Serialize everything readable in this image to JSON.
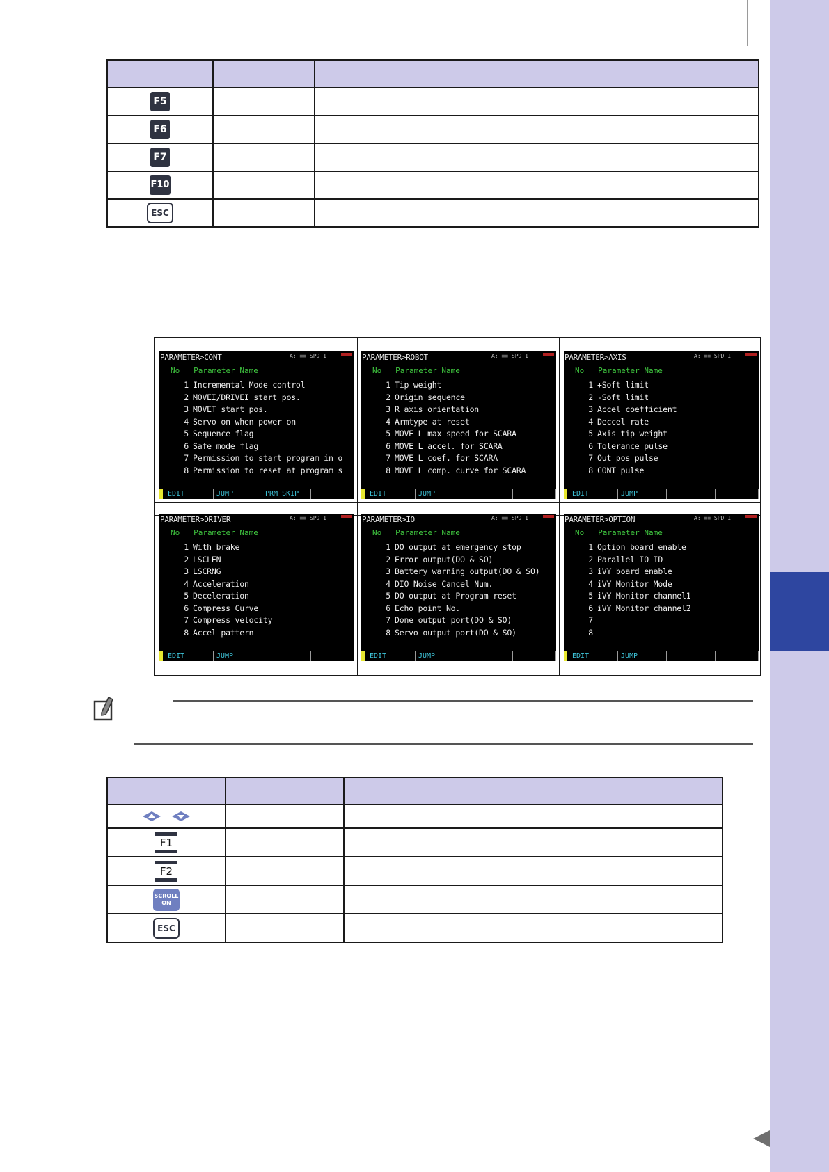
{
  "table1": {
    "header": [
      "",
      "",
      ""
    ],
    "rows": [
      {
        "key": "F5",
        "name": "",
        "desc": ""
      },
      {
        "key": "F6",
        "name": "",
        "desc": ""
      },
      {
        "key": "F7",
        "name": "",
        "desc": ""
      },
      {
        "key": "F10",
        "name": "",
        "desc": ""
      },
      {
        "key": "ESC",
        "name": "",
        "desc": ""
      }
    ]
  },
  "screens": [
    {
      "title": "PARAMETER>CONT",
      "status": "A: ≡≡ SPD 1",
      "head": "No   Parameter Name",
      "rows": [
        {
          "no": "1",
          "name": "Incremental Mode control"
        },
        {
          "no": "2",
          "name": "MOVEI/DRIVEI start pos."
        },
        {
          "no": "3",
          "name": "MOVET start pos."
        },
        {
          "no": "4",
          "name": "Servo on when power on"
        },
        {
          "no": "5",
          "name": "Sequence flag"
        },
        {
          "no": "6",
          "name": "Safe mode flag"
        },
        {
          "no": "7",
          "name": "Permission to start program in o"
        },
        {
          "no": "8",
          "name": "Permission to reset at program s"
        }
      ],
      "footer": [
        "EDIT",
        "JUMP",
        "PRM SKIP",
        ""
      ]
    },
    {
      "title": "PARAMETER>ROBOT",
      "status": "A: ≡≡ SPD 1",
      "head": "No   Parameter Name",
      "rows": [
        {
          "no": "1",
          "name": "Tip weight"
        },
        {
          "no": "2",
          "name": "Origin sequence"
        },
        {
          "no": "3",
          "name": "R axis orientation"
        },
        {
          "no": "4",
          "name": "Armtype at reset"
        },
        {
          "no": "5",
          "name": "MOVE L max speed for SCARA"
        },
        {
          "no": "6",
          "name": "MOVE L accel. for SCARA"
        },
        {
          "no": "7",
          "name": "MOVE L coef. for SCARA"
        },
        {
          "no": "8",
          "name": "MOVE L comp. curve for SCARA"
        }
      ],
      "footer": [
        "EDIT",
        "JUMP",
        "",
        ""
      ]
    },
    {
      "title": "PARAMETER>AXIS",
      "status": "A: ≡≡ SPD 1",
      "head": "No   Parameter Name",
      "rows": [
        {
          "no": "1",
          "name": "+Soft limit"
        },
        {
          "no": "2",
          "name": "-Soft limit"
        },
        {
          "no": "3",
          "name": "Accel coefficient"
        },
        {
          "no": "4",
          "name": "Deccel rate"
        },
        {
          "no": "5",
          "name": "Axis tip weight"
        },
        {
          "no": "6",
          "name": "Tolerance pulse"
        },
        {
          "no": "7",
          "name": "Out pos pulse"
        },
        {
          "no": "8",
          "name": "CONT pulse"
        }
      ],
      "footer": [
        "EDIT",
        "JUMP",
        "",
        ""
      ]
    },
    {
      "title": "PARAMETER>DRIVER",
      "status": "A: ≡≡ SPD 1",
      "head": "No   Parameter Name",
      "rows": [
        {
          "no": "1",
          "name": "With brake"
        },
        {
          "no": "2",
          "name": "LSCLEN"
        },
        {
          "no": "3",
          "name": "LSCRNG"
        },
        {
          "no": "4",
          "name": "Acceleration"
        },
        {
          "no": "5",
          "name": "Deceleration"
        },
        {
          "no": "6",
          "name": "Compress Curve"
        },
        {
          "no": "7",
          "name": "Compress velocity"
        },
        {
          "no": "8",
          "name": "Accel pattern"
        }
      ],
      "footer": [
        "EDIT",
        "JUMP",
        "",
        ""
      ]
    },
    {
      "title": "PARAMETER>IO",
      "status": "A: ≡≡ SPD 1",
      "head": "No   Parameter Name",
      "rows": [
        {
          "no": "1",
          "name": "DO output at emergency stop"
        },
        {
          "no": "2",
          "name": "Error output(DO & SO)"
        },
        {
          "no": "3",
          "name": "Battery warning output(DO & SO)"
        },
        {
          "no": "4",
          "name": "DIO Noise Cancel Num."
        },
        {
          "no": "5",
          "name": "DO output at Program reset"
        },
        {
          "no": "6",
          "name": "Echo point No."
        },
        {
          "no": "7",
          "name": "Done output port(DO & SO)"
        },
        {
          "no": "8",
          "name": "Servo output port(DO & SO)"
        }
      ],
      "footer": [
        "EDIT",
        "JUMP",
        "",
        ""
      ]
    },
    {
      "title": "PARAMETER>OPTION",
      "status": "A: ≡≡ SPD 1",
      "head": "No   Parameter Name",
      "rows": [
        {
          "no": "1",
          "name": "Option board enable"
        },
        {
          "no": "2",
          "name": "Parallel IO ID"
        },
        {
          "no": "3",
          "name": "iVY board enable"
        },
        {
          "no": "4",
          "name": "iVY Monitor Mode"
        },
        {
          "no": "5",
          "name": "iVY Monitor channel1"
        },
        {
          "no": "6",
          "name": "iVY Monitor channel2"
        },
        {
          "no": "7",
          "name": ""
        },
        {
          "no": "8",
          "name": ""
        }
      ],
      "footer": [
        "EDIT",
        "JUMP",
        "",
        ""
      ]
    }
  ],
  "table2": {
    "header": [
      "",
      "",
      ""
    ],
    "rows": [
      {
        "key": "up-down-arrows",
        "name": "",
        "desc": ""
      },
      {
        "key": "F1",
        "name": "",
        "desc": ""
      },
      {
        "key": "F2",
        "name": "",
        "desc": ""
      },
      {
        "key": "SCROLL ON",
        "key_line1": "SCROLL",
        "key_line2": "ON",
        "name": "",
        "desc": ""
      },
      {
        "key": "ESC",
        "name": "",
        "desc": ""
      }
    ]
  },
  "colors": {
    "accent_lavender": "#cdcae9",
    "side_tab_blue": "#2e46a0",
    "key_dark": "#2f3341",
    "scroll_key": "#6f7fc0",
    "screen_green": "#3ec33e",
    "screen_cyan": "#3ec3d8"
  },
  "icons": {
    "note": "pencil-note-icon",
    "page_nav": "triangle-left-icon"
  }
}
